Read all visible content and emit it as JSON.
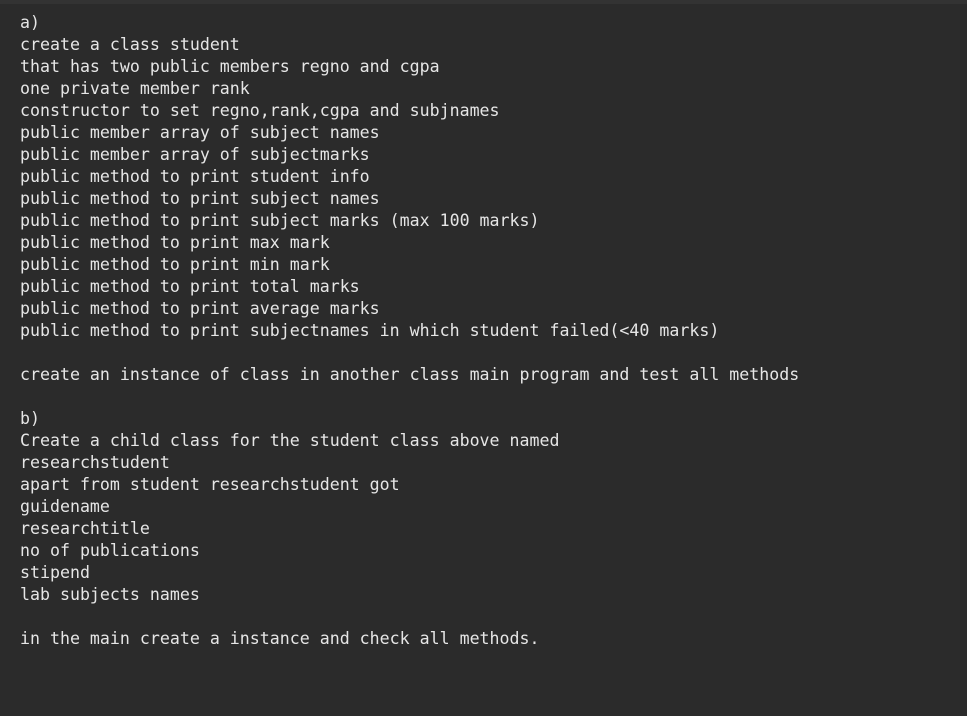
{
  "document": {
    "background_color": "#2b2b2b",
    "text_color": "#e6e6e6",
    "top_band_color": "#333333",
    "lines": [
      "a)",
      "create a class student",
      "that has two public members regno and cgpa",
      "one private member rank",
      "constructor to set regno,rank,cgpa and subjnames",
      "public member array of subject names",
      "public member array of subjectmarks",
      "public method to print student info",
      "public method to print subject names",
      "public method to print subject marks (max 100 marks)",
      "public method to print max mark",
      "public method to print min mark",
      "public method to print total marks",
      "public method to print average marks",
      "public method to print subjectnames in which student failed(<40 marks)",
      "",
      "create an instance of class in another class main program and test all methods",
      "",
      "b)",
      "Create a child class for the student class above named",
      "researchstudent",
      "apart from student researchstudent got",
      "guidename",
      "researchtitle",
      "no of publications",
      "stipend",
      "lab subjects names",
      "",
      "in the main create a instance and check all methods."
    ]
  }
}
